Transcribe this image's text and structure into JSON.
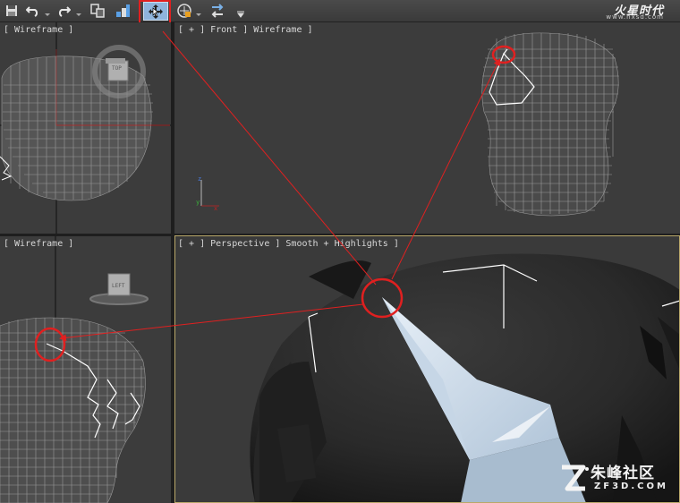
{
  "toolbar": {
    "buttons": [
      {
        "name": "save-icon"
      },
      {
        "name": "undo-icon"
      },
      {
        "name": "redo-icon"
      },
      {
        "name": "select-link-icon"
      },
      {
        "name": "bind-spacewarp-icon"
      },
      {
        "name": "select-and-move-icon",
        "active": true
      },
      {
        "name": "select-filter-icon"
      },
      {
        "name": "reference-coordinate-icon"
      }
    ]
  },
  "logo": {
    "title": "火星时代",
    "url": "www.hxsd.com"
  },
  "viewports": {
    "top_left": {
      "label": "[ Wireframe ]",
      "cube_label": "TOP"
    },
    "top_right": {
      "label": "[ + ] Front ] Wireframe ]"
    },
    "bottom_left": {
      "label": "[ Wireframe ]",
      "cube_label": "LEFT"
    },
    "bottom_right": {
      "label": "[ + ] Perspective ] Smooth + Highlights ]"
    }
  },
  "watermark": {
    "text": "朱峰社区",
    "url": "ZF3D.COM"
  },
  "colors": {
    "viewport_bg": "#3c3c3c",
    "wire": "#9a9a9a",
    "annotation_red": "#e02020",
    "active_viewport_border": "#b9a86a"
  }
}
